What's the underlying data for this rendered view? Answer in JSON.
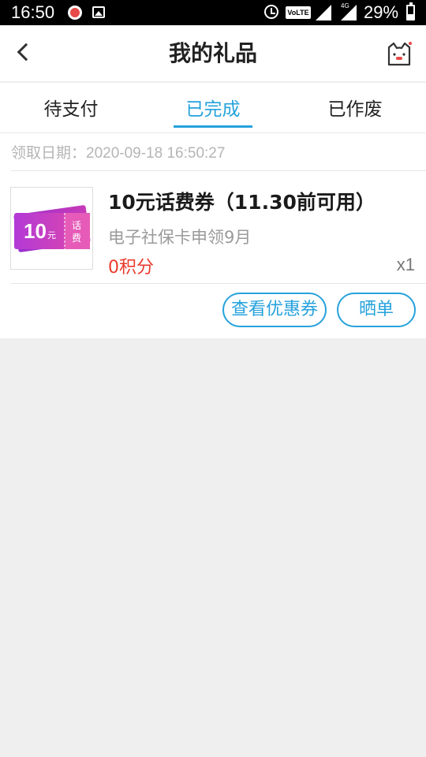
{
  "status_bar": {
    "time": "16:50",
    "volte": "VoLTE",
    "network": "4G",
    "battery": "29%"
  },
  "header": {
    "title": "我的礼品"
  },
  "tabs": [
    {
      "label": "待支付",
      "active": false
    },
    {
      "label": "已完成",
      "active": true
    },
    {
      "label": "已作废",
      "active": false
    }
  ],
  "order": {
    "date": "领取日期：2020-09-18 16:50:27",
    "thumbnail": {
      "amount": "10",
      "unit": "元",
      "tag_line1": "话",
      "tag_line2": "费"
    },
    "title": "10元话费券（11.30前可用）",
    "subtitle": "电子社保卡申领9月",
    "points": "0积分",
    "quantity": "x1",
    "buttons": {
      "view_coupon": "查看优惠券",
      "share": "晒单"
    }
  },
  "colors": {
    "accent": "#26a2dc",
    "points": "#ea3a2c",
    "background": "#efefef"
  }
}
